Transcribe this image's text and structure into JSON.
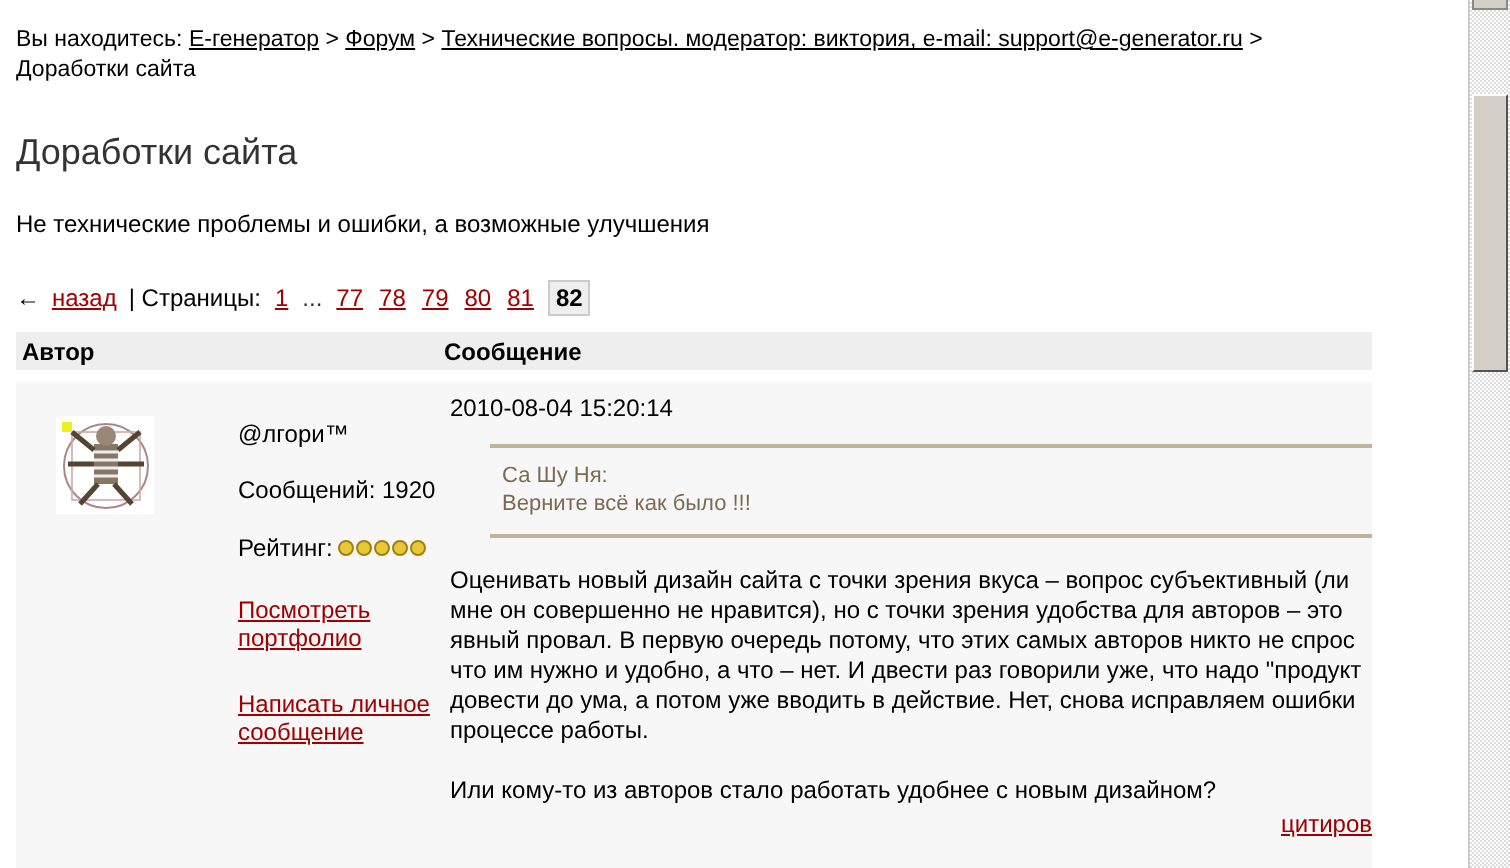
{
  "breadcrumb": {
    "label": "Вы находитесь:",
    "links": [
      {
        "label": "E-генератор",
        "separator": ">"
      },
      {
        "label": "Форум",
        "separator": ">"
      },
      {
        "label": "Технические вопросы. модератор: виктория, e-mail: support@e-generator.ru",
        "separator": ">"
      }
    ],
    "current": "Доработки сайта"
  },
  "title": "Доработки сайта",
  "subtitle": "Не технические проблемы и ошибки, а возможные улучшения",
  "pagination": {
    "arrow": "←",
    "back": "назад",
    "label": "| Страницы:",
    "pages": [
      {
        "label": "1",
        "selected": false
      },
      {
        "label": "...",
        "kind": "gap"
      },
      {
        "label": "77",
        "selected": false
      },
      {
        "label": "78",
        "selected": false
      },
      {
        "label": "79",
        "selected": false
      },
      {
        "label": "80",
        "selected": false
      },
      {
        "label": "81",
        "selected": false
      },
      {
        "label": "82",
        "selected": true
      }
    ]
  },
  "table": {
    "columns": [
      "Автор",
      "Сообщение"
    ],
    "post": {
      "author": "@лгори™",
      "posts": "Сообщений: 1920",
      "rating_label": "Рейтинг:",
      "stars": 5,
      "links": [
        "Посмотреть портфолио",
        "Написать личное сообщение"
      ],
      "date": "2010-08-04 15:20:14",
      "quote": {
        "author": "Са Шу Ня:",
        "text": "Верните всё как было !!!"
      },
      "body_lines": [
        "Оценивать новый дизайн сайта с точки зрения вкуса – вопрос субъективный (ли",
        "мне он совершенно не нравится), но с точки зрения удобства для авторов – это",
        "явный провал. В первую очередь потому, что этих самых авторов никто не спрос",
        "что им нужно и удобно, а что – нет. И двести раз говорили уже, что надо \"продукт",
        "довести до ума, а потом уже вводить в действие. Нет, снова исправляем ошибки",
        "процессе работы."
      ],
      "closing": "Или кому-то из авторов стало работать удобнее с новым дизайном?",
      "quote_link": "цитиров"
    }
  }
}
